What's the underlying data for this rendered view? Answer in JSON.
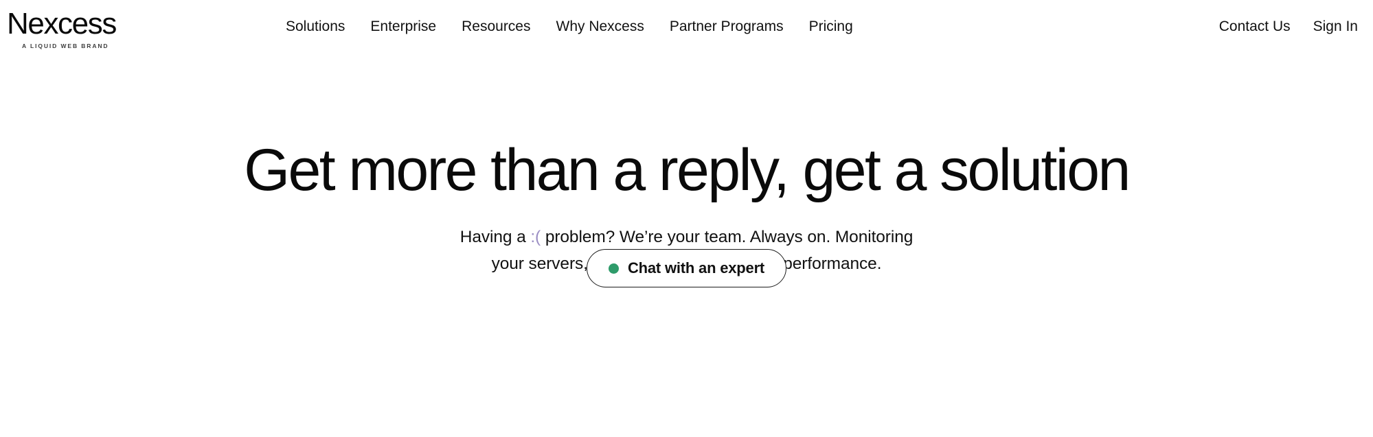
{
  "page": {
    "background_color": "#ffffff",
    "text_color": "#111111"
  },
  "header": {
    "brand": {
      "wordmark": "Nexcess",
      "tagline": "A LIQUID WEB BRAND"
    },
    "primary_nav": [
      {
        "label": "Solutions"
      },
      {
        "label": "Enterprise"
      },
      {
        "label": "Resources"
      },
      {
        "label": "Why Nexcess"
      },
      {
        "label": "Partner Programs"
      },
      {
        "label": "Pricing"
      }
    ],
    "utility_nav": [
      {
        "label": "Contact Us"
      },
      {
        "label": "Sign In"
      }
    ]
  },
  "hero": {
    "headline": "Get more than a reply, get a solution",
    "subcopy": {
      "line1_before_emoticon": "Having a ",
      "emoticon": ":(",
      "emoticon_color": "#9b8ec4",
      "line1_after_emoticon": " problem? We’re your team. Always on. Monitoring",
      "line2": "your servers, mitigating risk, optimizing performance."
    },
    "cta": {
      "label": "Chat with an expert",
      "status_dot_color": "#2e9b6a",
      "status_dot_name": "online-status-dot",
      "border_color": "#1b1b1b",
      "background_color": "#ffffff"
    }
  }
}
